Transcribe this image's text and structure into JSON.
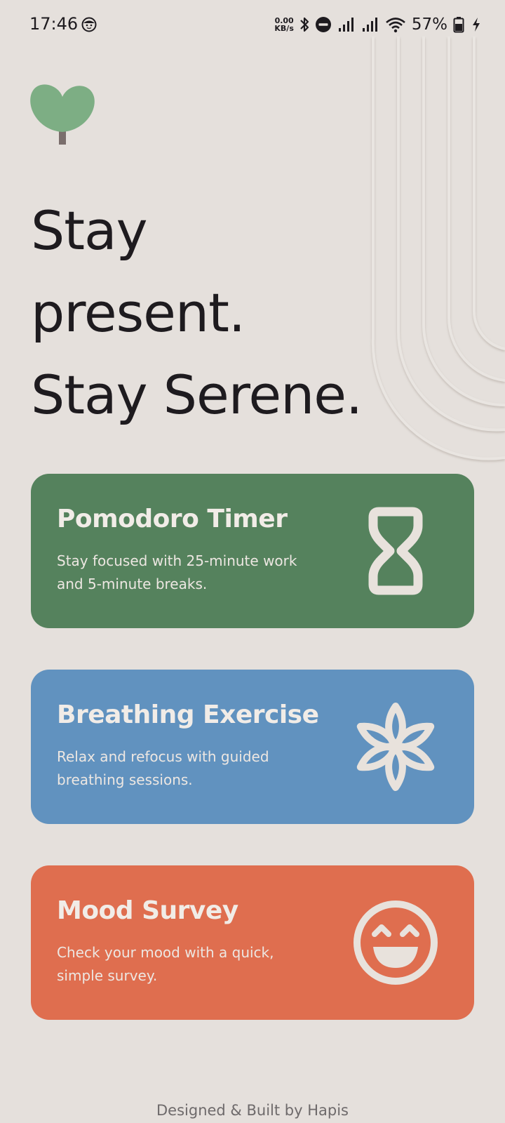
{
  "status_bar": {
    "time": "17:46",
    "net_speed_value": "0.00",
    "net_speed_unit": "KB/s",
    "battery_percent": "57%"
  },
  "headline": {
    "line1": "Stay",
    "line2": "present.",
    "line3": "Stay Serene."
  },
  "cards": [
    {
      "title": "Pomodoro Timer",
      "description": "Stay focused with 25-minute work and 5-minute breaks.",
      "icon": "hourglass-icon",
      "color": "#55825D"
    },
    {
      "title": "Breathing Exercise",
      "description": "Relax and refocus with guided breathing sessions.",
      "icon": "flower-icon",
      "color": "#6192BF"
    },
    {
      "title": "Mood Survey",
      "description": "Check your mood with a quick, simple survey.",
      "icon": "smiley-icon",
      "color": "#DF6E4F"
    }
  ],
  "footer": {
    "credit": "Designed & Built by Hapis"
  },
  "colors": {
    "background": "#E5E0DC",
    "text": "#1E1B1F",
    "logo_green": "#7DAE84",
    "logo_trunk": "#7A6E6C"
  }
}
